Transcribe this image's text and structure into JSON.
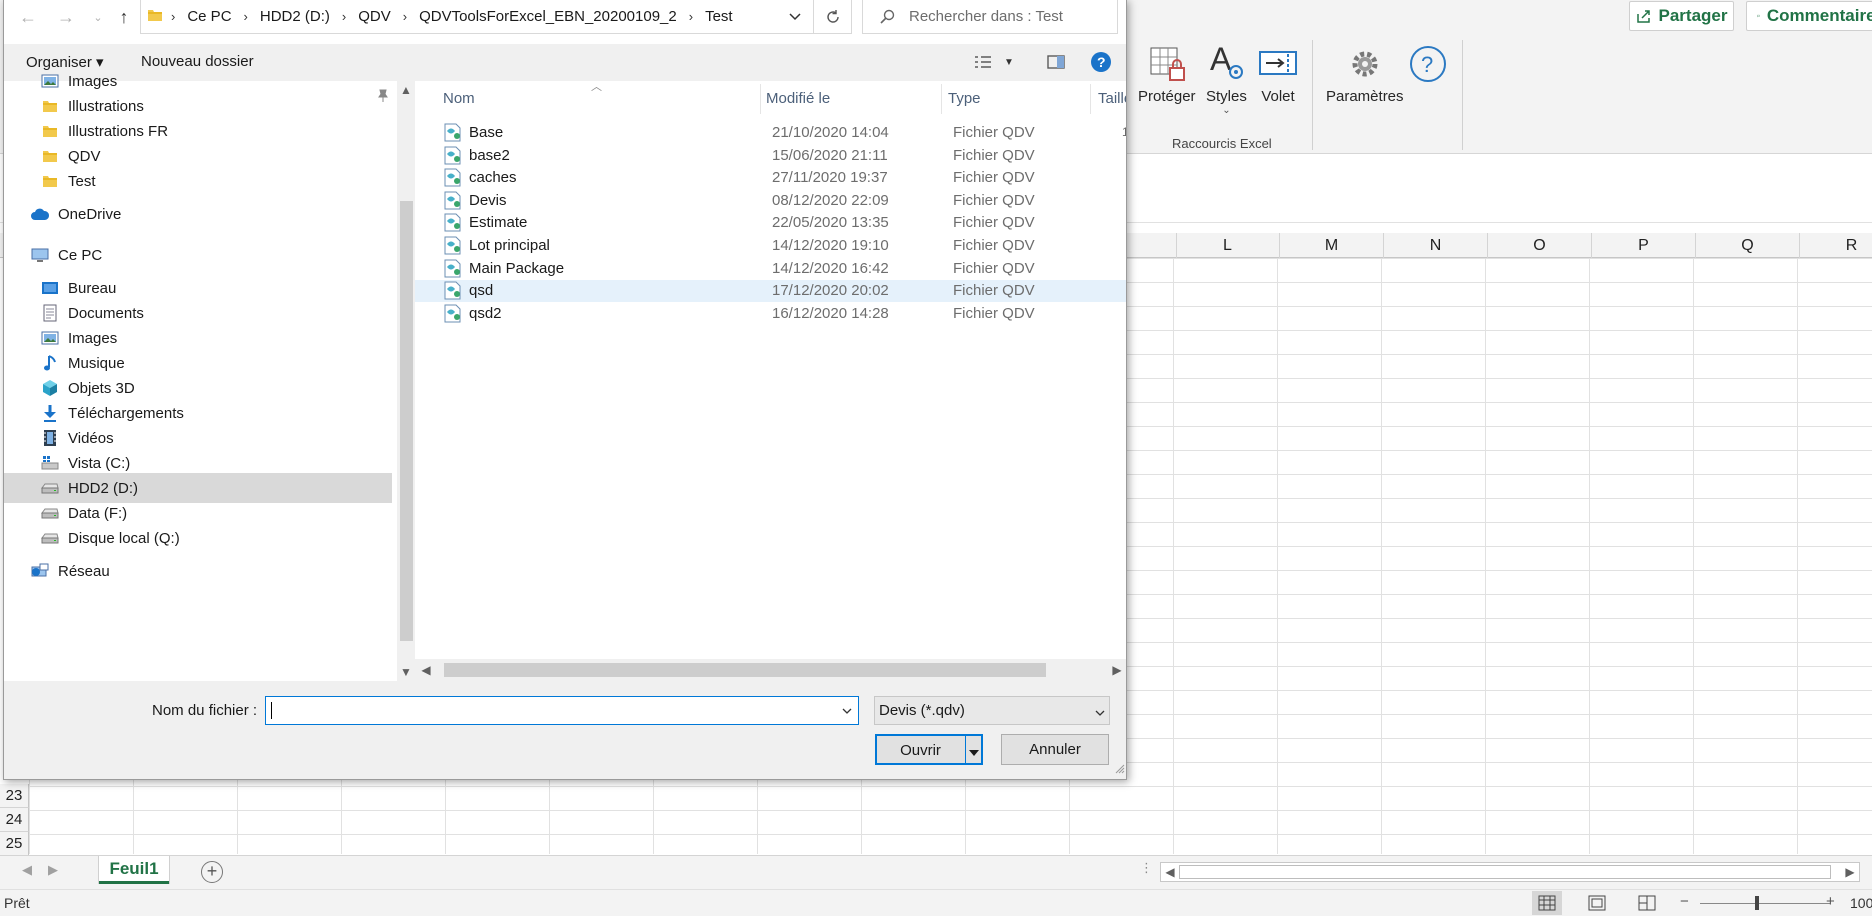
{
  "excel": {
    "ribbon": {
      "share_label": "Partager",
      "comments_label": "Commentaires",
      "buttons": [
        "Protéger",
        "Styles",
        "Volet",
        "Paramètres"
      ],
      "group_label": "Raccourcis Excel"
    },
    "columns": [
      "L",
      "M",
      "N",
      "O",
      "P",
      "Q",
      "R"
    ],
    "row_numbers": [
      "23",
      "24",
      "25"
    ],
    "sheet_tab": "Feuil1",
    "status": "Prêt",
    "zoom_text": "100",
    "accent_color": "#217346"
  },
  "dialog": {
    "breadcrumb": [
      "Ce PC",
      "HDD2 (D:)",
      "QDV",
      "QDVToolsForExcel_EBN_20200109_2",
      "Test"
    ],
    "search_placeholder": "Rechercher dans : Test",
    "toolbar": {
      "organize_label": "Organiser ▾",
      "new_folder_label": "Nouveau dossier"
    },
    "nav_items": [
      {
        "label": "Images",
        "icon": "pictures-icon",
        "indent": 1
      },
      {
        "label": "Illustrations",
        "icon": "folder-icon",
        "indent": 1
      },
      {
        "label": "Illustrations FR",
        "icon": "folder-icon",
        "indent": 1
      },
      {
        "label": "QDV",
        "icon": "folder-icon",
        "indent": 1
      },
      {
        "label": "Test",
        "icon": "folder-icon",
        "indent": 1
      },
      {
        "label": "OneDrive",
        "icon": "cloud-icon",
        "indent": 0
      },
      {
        "label": "Ce PC",
        "icon": "computer-icon",
        "indent": 0
      },
      {
        "label": "Bureau",
        "icon": "desktop-icon",
        "indent": 1
      },
      {
        "label": "Documents",
        "icon": "documents-icon",
        "indent": 1
      },
      {
        "label": "Images",
        "icon": "pictures-icon",
        "indent": 1
      },
      {
        "label": "Musique",
        "icon": "music-icon",
        "indent": 1
      },
      {
        "label": "Objets 3D",
        "icon": "cube-icon",
        "indent": 1
      },
      {
        "label": "Téléchargements",
        "icon": "download-icon",
        "indent": 1
      },
      {
        "label": "Vidéos",
        "icon": "video-icon",
        "indent": 1
      },
      {
        "label": "Vista (C:)",
        "icon": "windows-drive-icon",
        "indent": 1
      },
      {
        "label": "HDD2 (D:)",
        "icon": "drive-icon",
        "indent": 1,
        "selected": true
      },
      {
        "label": "Data (F:)",
        "icon": "drive-icon",
        "indent": 1
      },
      {
        "label": "Disque local (Q:)",
        "icon": "drive-icon",
        "indent": 1
      },
      {
        "label": "Réseau",
        "icon": "network-icon",
        "indent": 0
      }
    ],
    "columns": [
      "Nom",
      "Modifié le",
      "Type",
      "Taille"
    ],
    "files": [
      {
        "name": "Base",
        "date": "21/10/2020 14:04",
        "type": "Fichier QDV"
      },
      {
        "name": "base2",
        "date": "15/06/2020 21:11",
        "type": "Fichier QDV"
      },
      {
        "name": "caches",
        "date": "27/11/2020 19:37",
        "type": "Fichier QDV"
      },
      {
        "name": "Devis",
        "date": "08/12/2020 22:09",
        "type": "Fichier QDV"
      },
      {
        "name": "Estimate",
        "date": "22/05/2020 13:35",
        "type": "Fichier QDV"
      },
      {
        "name": "Lot principal",
        "date": "14/12/2020 19:10",
        "type": "Fichier QDV"
      },
      {
        "name": "Main Package",
        "date": "14/12/2020 16:42",
        "type": "Fichier QDV"
      },
      {
        "name": "qsd",
        "date": "17/12/2020 20:02",
        "type": "Fichier QDV",
        "selected": true
      },
      {
        "name": "qsd2",
        "date": "16/12/2020 14:28",
        "type": "Fichier QDV"
      }
    ],
    "filename_label": "Nom du fichier :",
    "filename_value": "",
    "filter_value": "Devis (*.qdv)",
    "open_label": "Ouvrir",
    "cancel_label": "Annuler",
    "selection_color": "#e5f1fb",
    "focus_color": "#0078d7"
  }
}
